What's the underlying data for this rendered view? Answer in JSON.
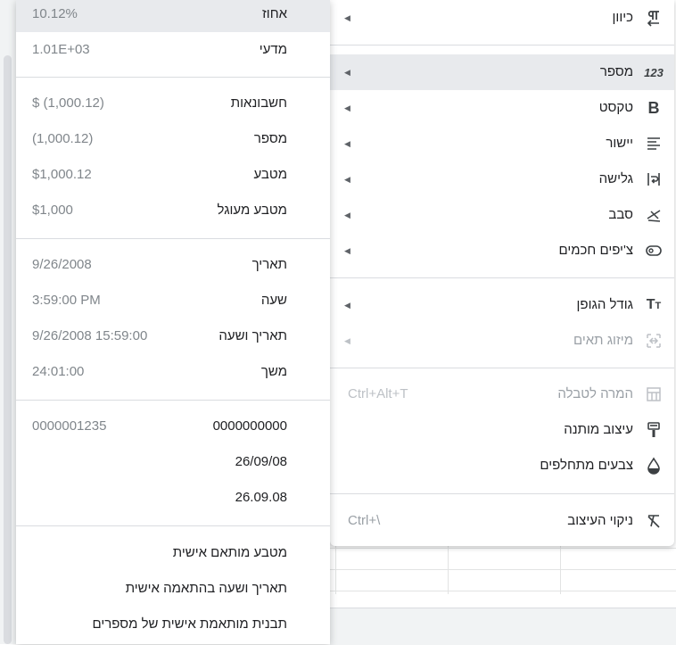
{
  "main_menu": {
    "items": [
      {
        "label": "כיוון",
        "icon": "text-direction-icon",
        "has_submenu": true
      },
      {
        "label": "מספר",
        "icon": "number-123-icon",
        "has_submenu": true
      },
      {
        "label": "טקסט",
        "icon": "bold-icon",
        "has_submenu": true
      },
      {
        "label": "יישור",
        "icon": "align-icon",
        "has_submenu": true
      },
      {
        "label": "גלישה",
        "icon": "text-wrap-icon",
        "has_submenu": true
      },
      {
        "label": "סבב",
        "icon": "text-rotation-icon",
        "has_submenu": true
      },
      {
        "label": "צ'יפים חכמים",
        "icon": "smart-chip-icon",
        "has_submenu": true
      },
      {
        "label": "גודל הגופן",
        "icon": "font-size-icon",
        "has_submenu": true
      },
      {
        "label": "מיזוג תאים",
        "icon": "merge-cells-icon",
        "has_submenu": true
      },
      {
        "label": "המרה לטבלה",
        "icon": "table-icon",
        "shortcut": "Ctrl+Alt+T"
      },
      {
        "label": "עיצוב מותנה",
        "icon": "paint-roller-icon"
      },
      {
        "label": "צבעים מתחלפים",
        "icon": "color-drop-icon"
      },
      {
        "label": "ניקוי העיצוב",
        "icon": "clear-format-icon",
        "shortcut": "Ctrl+\\"
      }
    ]
  },
  "number_submenu": {
    "items": [
      {
        "name": "אחוז",
        "example": "10.12%"
      },
      {
        "name": "מדעי",
        "example": "1.01E+03"
      },
      {
        "name": "חשבונאות",
        "example": "$ (1,000.12)"
      },
      {
        "name": "מספר",
        "example": "(1,000.12)"
      },
      {
        "name": "מטבע",
        "example": "$1,000.12"
      },
      {
        "name": "מטבע מעוגל",
        "example": "$1,000"
      },
      {
        "name": "תאריך",
        "example": "9/26/2008"
      },
      {
        "name": "שעה",
        "example": "3:59:00 PM"
      },
      {
        "name": "תאריך ושעה",
        "example": "9/26/2008 15:59:00"
      },
      {
        "name": "משך",
        "example": "24:01:00"
      },
      {
        "name": "0000000000",
        "example": "0000001235"
      },
      {
        "name": "26/09/08",
        "example": ""
      },
      {
        "name": "26.09.08",
        "example": ""
      },
      {
        "name": "מטבע מותאם אישית",
        "example": ""
      },
      {
        "name": "תאריך ושעה בהתאמה אישית",
        "example": ""
      },
      {
        "name": "תבנית מותאמת אישית של מספרים",
        "example": ""
      }
    ]
  },
  "colors": {
    "highlight": "#e8eaed",
    "text": "#202124",
    "muted": "#80868b",
    "disabled": "#9aa0a6"
  }
}
